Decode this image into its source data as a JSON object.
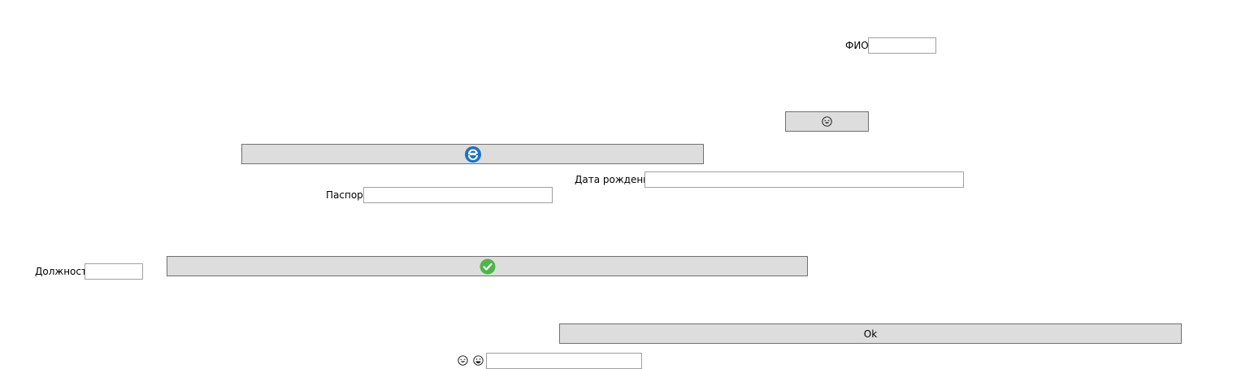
{
  "form": {
    "fio_label": "ФИО",
    "fio_value": "",
    "birthdate_label": "Дата рождения",
    "birthdate_value": "",
    "passport_label": "Паспорт",
    "passport_value": "",
    "position_label": "Должность",
    "position_value": "",
    "bottom_value": ""
  },
  "buttons": {
    "emoji_button_icon": "laughing-face-icon",
    "refresh_button_icon": "blue-refresh-icon",
    "check_button_icon": "green-check-icon",
    "ok_label": "Ok"
  },
  "bottom_icons": [
    "laughing-face-icon",
    "grinning-face-icon"
  ],
  "colors": {
    "button_bg": "#dddddd",
    "button_border": "#707070",
    "field_border": "#a0a0a0",
    "refresh_blue": "#1a73c8",
    "check_green": "#4cb748"
  }
}
